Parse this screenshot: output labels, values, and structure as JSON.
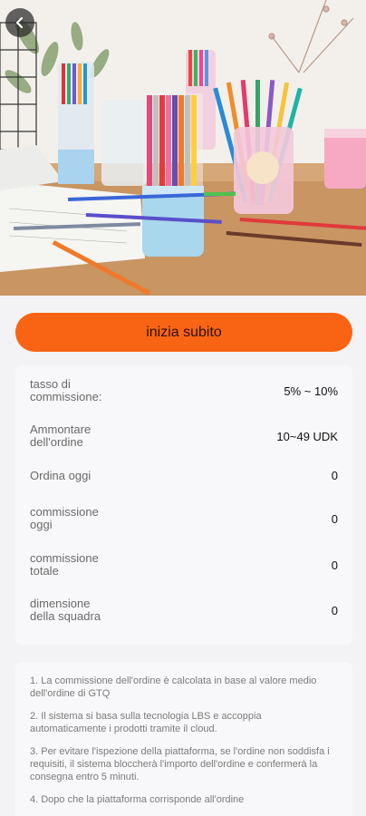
{
  "header": {
    "back_icon": "chevron-left-icon"
  },
  "hero": {
    "description_icon": "product-photo-markers"
  },
  "cta": {
    "label": "inizia subito"
  },
  "stats": [
    {
      "label": "tasso di commissione:",
      "value": "5% ~ 10%"
    },
    {
      "label": "Ammontare dell'ordine",
      "value": "10~49 UDK"
    },
    {
      "label": "Ordina oggi",
      "value": "0"
    },
    {
      "label": "commissione oggi",
      "value": "0"
    },
    {
      "label": "commissione totale",
      "value": "0"
    },
    {
      "label": "dimensione della squadra",
      "value": "0"
    }
  ],
  "notes": [
    "1. La commissione dell'ordine è calcolata in base al valore medio dell'ordine di GTQ",
    "2. Il sistema si basa sulla tecnologia LBS e accoppia automaticamente i prodotti tramite il cloud.",
    "3. Per evitare l'ispezione della piattaforma, se l'ordine non soddisfa i requisiti, il sistema bloccherà l'importo dell'ordine e confermerà la consegna entro 5 minuti.",
    "4. Dopo che la piattaforma corrisponde all'ordine"
  ]
}
